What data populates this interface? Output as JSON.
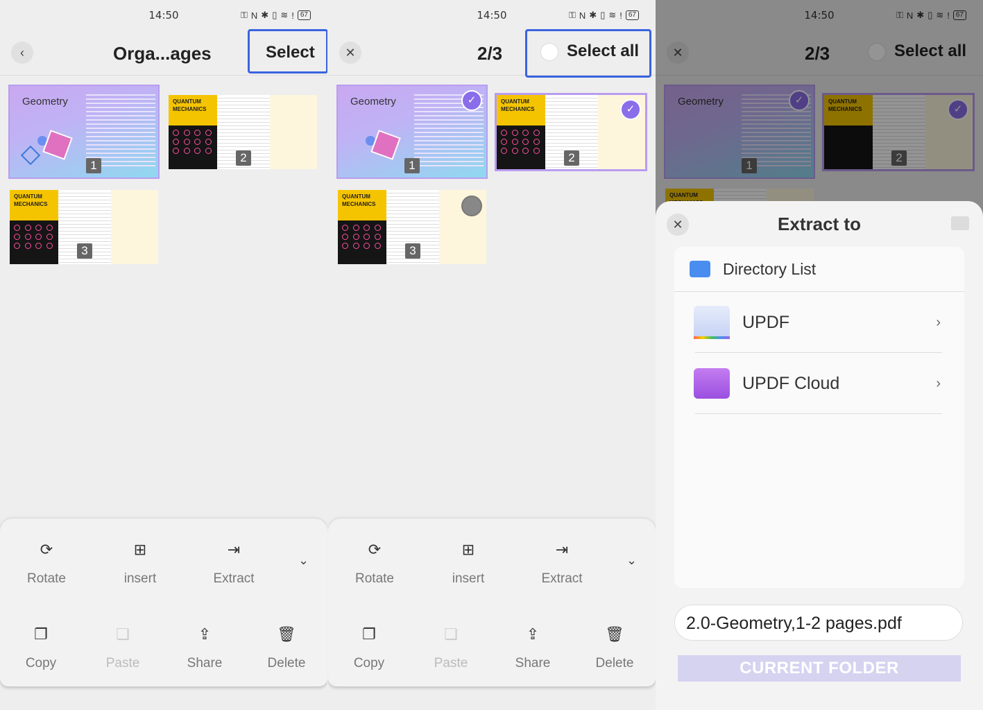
{
  "status": {
    "time": "14:50",
    "battery": "67"
  },
  "screen1": {
    "back_icon": "chevron-left-icon",
    "title": "Orga...ages",
    "select_label": "Select",
    "pages": [
      {
        "title": "Geometry",
        "number": "1"
      },
      {
        "title": "QUANTUM MECHANICS",
        "number": "2"
      },
      {
        "title": "QUANTUM MECHANICS",
        "number": "3"
      }
    ]
  },
  "screen2": {
    "close_icon": "close-icon",
    "counter": "2/3",
    "select_all_label": "Select all",
    "selected_pages": [
      1,
      2
    ]
  },
  "tools": {
    "rotate": "Rotate",
    "insert": "insert",
    "extract": "Extract",
    "copy": "Copy",
    "paste": "Paste",
    "share": "Share",
    "delete": "Delete"
  },
  "screen3": {
    "counter": "2/3",
    "select_all_label": "Select all",
    "dialog": {
      "title": "Extract to",
      "directory_header": "Directory List",
      "folders": [
        {
          "name": "UPDF",
          "icon": "updf-folder-icon"
        },
        {
          "name": "UPDF Cloud",
          "icon": "cloud-folder-icon"
        }
      ],
      "file_name": "2.0-Geometry,1-2 pages.pdf",
      "current_folder_button": "CURRENT FOLDER"
    }
  },
  "colors": {
    "accent": "#8a6de9",
    "highlight_box": "#3a63e0",
    "button_disabled": "#d5d3f0"
  }
}
